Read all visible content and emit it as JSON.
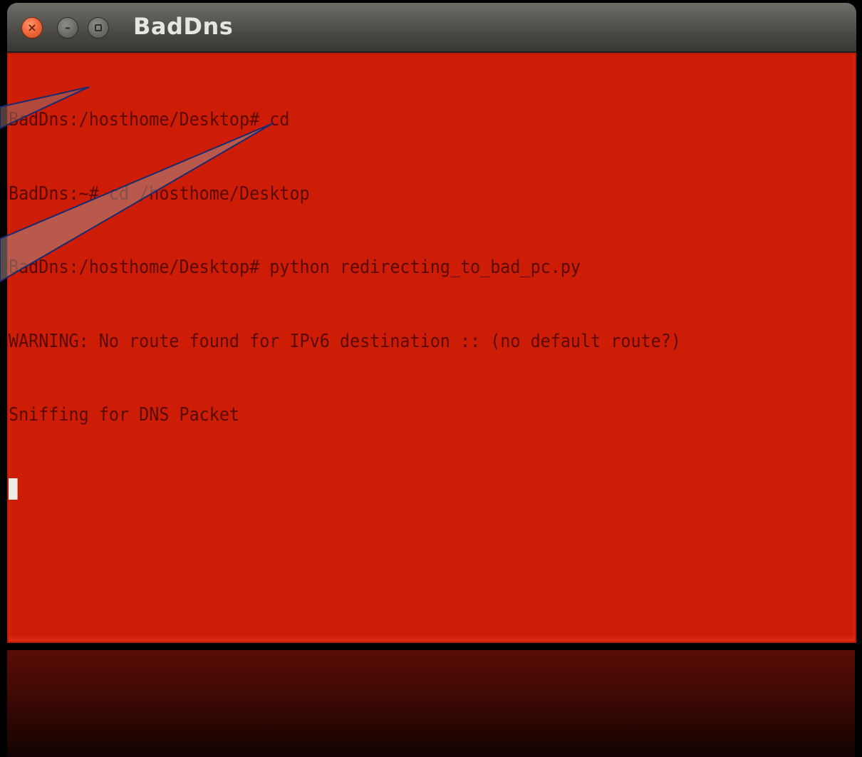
{
  "window": {
    "title": "BadDns",
    "close_glyph": "×",
    "minimize_glyph": "–"
  },
  "terminal": {
    "background_color": "#cd1d06",
    "text_color": "#5a0a05",
    "lines": [
      "BadDns:/hosthome/Desktop# cd",
      "BadDns:~# cd /hosthome/Desktop",
      "BadDns:/hosthome/Desktop# python redirecting_to_bad_pc.py",
      "WARNING: No route found for IPv6 destination :: (no default route?)",
      "Sniffing for DNS Packet"
    ]
  },
  "icons": {
    "close": "close-icon",
    "minimize": "minimize-icon",
    "maximize": "maximize-icon"
  }
}
